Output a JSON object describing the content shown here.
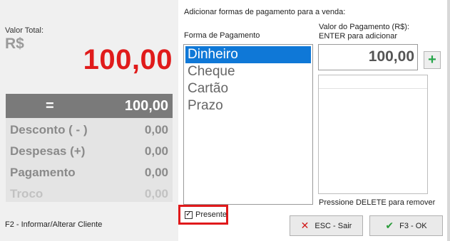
{
  "left": {
    "valor_total_label": "Valor Total:",
    "currency": "R$",
    "total": "100,00",
    "summary": {
      "equals_label": "=",
      "equals_value": "100,00",
      "rows": [
        {
          "label": "Desconto ( - )",
          "value": "0,00"
        },
        {
          "label": "Despesas (+)",
          "value": "0,00"
        },
        {
          "label": "Pagamento",
          "value": "0,00"
        },
        {
          "label": "Troco",
          "value": "0,00"
        }
      ]
    },
    "f2_hint": "F2 - Informar/Alterar Cliente"
  },
  "right": {
    "header": "Adicionar formas de pagamento para a venda:",
    "forma_label": "Forma de Pagamento",
    "forma_options": [
      "Dinheiro",
      "Cheque",
      "Cartão",
      "Prazo"
    ],
    "selected_option": "Dinheiro",
    "valor_pagamento_label": "Valor do Pagamento (R$):",
    "enter_hint": "ENTER para adicionar",
    "amount": "100,00",
    "add_symbol": "+",
    "delete_hint": "Pressione DELETE para remover",
    "presente_label": "Presente",
    "presente_checked": true,
    "esc_button": "ESC - Sair",
    "ok_button": "F3 - OK"
  },
  "colors": {
    "total_red": "#e01b1b",
    "selected_blue": "#0f78d7",
    "highlight_red": "#e0191b",
    "add_green": "#27a54a"
  }
}
